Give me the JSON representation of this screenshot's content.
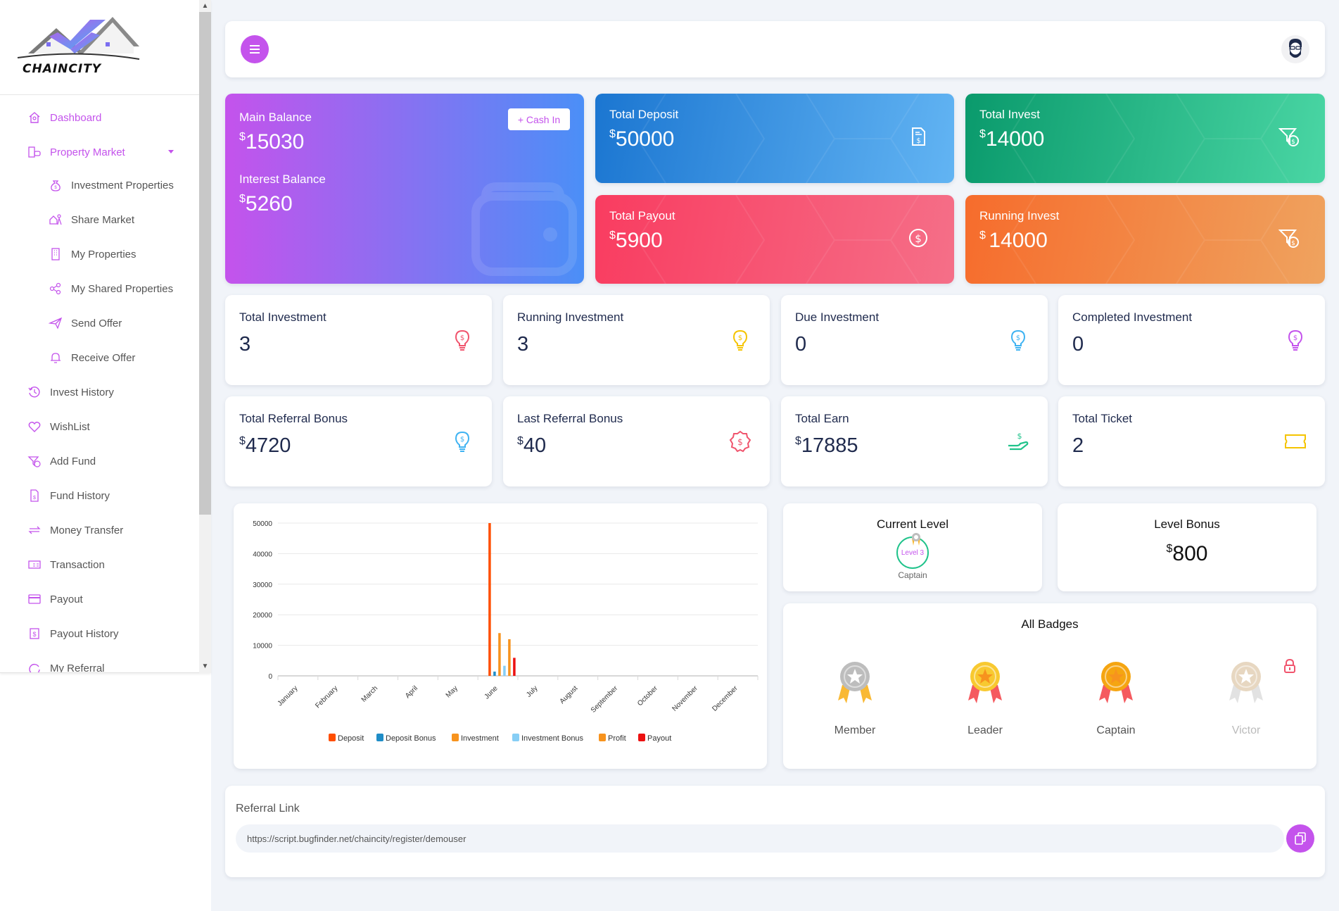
{
  "brand": {
    "name": "CHAINCITY"
  },
  "sidebar": {
    "items": [
      {
        "label": "Dashboard",
        "icon": "home-icon",
        "active": true,
        "level": 0
      },
      {
        "label": "Property Market",
        "icon": "buildings-icon",
        "active": true,
        "level": 0,
        "expanded": true
      },
      {
        "label": "Investment Properties",
        "icon": "money-bag-icon",
        "level": 1
      },
      {
        "label": "Share Market",
        "icon": "house-person-icon",
        "level": 1
      },
      {
        "label": "My Properties",
        "icon": "building-icon",
        "level": 1
      },
      {
        "label": "My Shared Properties",
        "icon": "share-icon",
        "level": 1
      },
      {
        "label": "Send Offer",
        "icon": "paper-plane-icon",
        "level": 1
      },
      {
        "label": "Receive Offer",
        "icon": "bell-icon",
        "level": 1
      },
      {
        "label": "Invest History",
        "icon": "history-icon",
        "level": 0
      },
      {
        "label": "WishList",
        "icon": "heart-icon",
        "level": 0
      },
      {
        "label": "Add Fund",
        "icon": "funnel-dollar-icon",
        "level": 0
      },
      {
        "label": "Fund History",
        "icon": "file-dollar-icon",
        "level": 0
      },
      {
        "label": "Money Transfer",
        "icon": "transfer-icon",
        "level": 0
      },
      {
        "label": "Transaction",
        "icon": "receipt-icon",
        "level": 0
      },
      {
        "label": "Payout",
        "icon": "credit-card-icon",
        "level": 0
      },
      {
        "label": "Payout History",
        "icon": "dollar-square-icon",
        "level": 0
      },
      {
        "label": "My Referral",
        "icon": "refresh-icon",
        "level": 0
      }
    ]
  },
  "header": {
    "menu_icon": "hamburger-icon",
    "avatar_icon": "user-avatar-icon"
  },
  "balance": {
    "main_label": "Main Balance",
    "currency": "$",
    "main_value": "15030",
    "interest_label": "Interest Balance",
    "interest_value": "5260",
    "cash_in_label": "+ Cash In"
  },
  "summary_cards": [
    {
      "label": "Total Deposit",
      "currency": "$",
      "value": "50000",
      "icon": "file-dollar-icon"
    },
    {
      "label": "Total Invest",
      "currency": "$",
      "value": "14000",
      "icon": "funnel-dollar-icon"
    },
    {
      "label": "Total Payout",
      "currency": "$",
      "value": "5900",
      "icon": "dollar-circle-icon"
    },
    {
      "label": "Running Invest",
      "currency": "$ ",
      "value": "14000",
      "icon": "funnel-dollar-icon"
    }
  ],
  "stats": [
    {
      "label": "Total Investment",
      "currency": "",
      "value": "3",
      "icon": "bulb-dollar-icon",
      "color": "#f0546d"
    },
    {
      "label": "Running Investment",
      "currency": "",
      "value": "3",
      "icon": "bulb-dollar-icon",
      "color": "#f5c400"
    },
    {
      "label": "Due Investment",
      "currency": "",
      "value": "0",
      "icon": "bulb-dollar-icon",
      "color": "#3fb3f2"
    },
    {
      "label": "Completed Investment",
      "currency": "",
      "value": "0",
      "icon": "bulb-dollar-icon",
      "color": "#c453ec"
    },
    {
      "label": "Total Referral Bonus",
      "currency": "$",
      "value": "4720",
      "icon": "bulb-dollar-icon",
      "color": "#3fb3f2"
    },
    {
      "label": "Last Referral Bonus",
      "currency": "$",
      "value": "40",
      "icon": "badge-dollar-icon",
      "color": "#f0546d"
    },
    {
      "label": "Total Earn",
      "currency": "$",
      "value": "17885",
      "icon": "hand-dollar-icon",
      "color": "#20c38b"
    },
    {
      "label": "Total Ticket",
      "currency": "",
      "value": "2",
      "icon": "ticket-icon",
      "color": "#f5c400"
    }
  ],
  "chart_data": {
    "type": "bar",
    "title": "",
    "xlabel": "",
    "ylabel": "",
    "categories": [
      "January",
      "February",
      "March",
      "April",
      "May",
      "June",
      "July",
      "August",
      "September",
      "October",
      "November",
      "December"
    ],
    "ylim": [
      0,
      50000
    ],
    "yticks": [
      0,
      10000,
      20000,
      30000,
      40000,
      50000
    ],
    "grid": true,
    "legend_position": "bottom",
    "series": [
      {
        "name": "Deposit",
        "color": "#ff4e00",
        "values": [
          0,
          0,
          0,
          0,
          0,
          50000,
          0,
          0,
          0,
          0,
          0,
          0
        ]
      },
      {
        "name": "Deposit Bonus",
        "color": "#1f8dc7",
        "values": [
          0,
          0,
          0,
          0,
          0,
          1400,
          0,
          0,
          0,
          0,
          0,
          0
        ]
      },
      {
        "name": "Investment",
        "color": "#f7931e",
        "values": [
          0,
          0,
          0,
          0,
          0,
          14000,
          0,
          0,
          0,
          0,
          0,
          0
        ]
      },
      {
        "name": "Investment Bonus",
        "color": "#87cef5",
        "values": [
          0,
          0,
          0,
          0,
          0,
          3300,
          0,
          0,
          0,
          0,
          0,
          0
        ]
      },
      {
        "name": "Profit",
        "color": "#f7931e",
        "values": [
          0,
          0,
          0,
          0,
          0,
          12000,
          0,
          0,
          0,
          0,
          0,
          0
        ]
      },
      {
        "name": "Payout",
        "color": "#ec1111",
        "values": [
          0,
          0,
          0,
          0,
          0,
          5900,
          0,
          0,
          0,
          0,
          0,
          0
        ]
      }
    ]
  },
  "level": {
    "title": "Current Level",
    "badge_text": "Level 3",
    "name": "Captain"
  },
  "level_bonus": {
    "title": "Level Bonus",
    "currency": "$",
    "value": "800"
  },
  "badges": {
    "title": "All Badges",
    "items": [
      {
        "name": "Member",
        "locked": false,
        "medal": "#bdbdbd",
        "ribbon": "#f9b934"
      },
      {
        "name": "Leader",
        "locked": false,
        "medal": "#f8c930",
        "ribbon": "#f55a5f"
      },
      {
        "name": "Captain",
        "locked": false,
        "medal": "#f5a511",
        "ribbon": "#f55a5f"
      },
      {
        "name": "Victor",
        "locked": true,
        "medal": "#e7d7c1",
        "ribbon": "#e2e2e2"
      }
    ]
  },
  "referral": {
    "title": "Referral Link",
    "link": "https://script.bugfinder.net/chaincity/register/demouser",
    "copy_icon": "copy-icon"
  }
}
